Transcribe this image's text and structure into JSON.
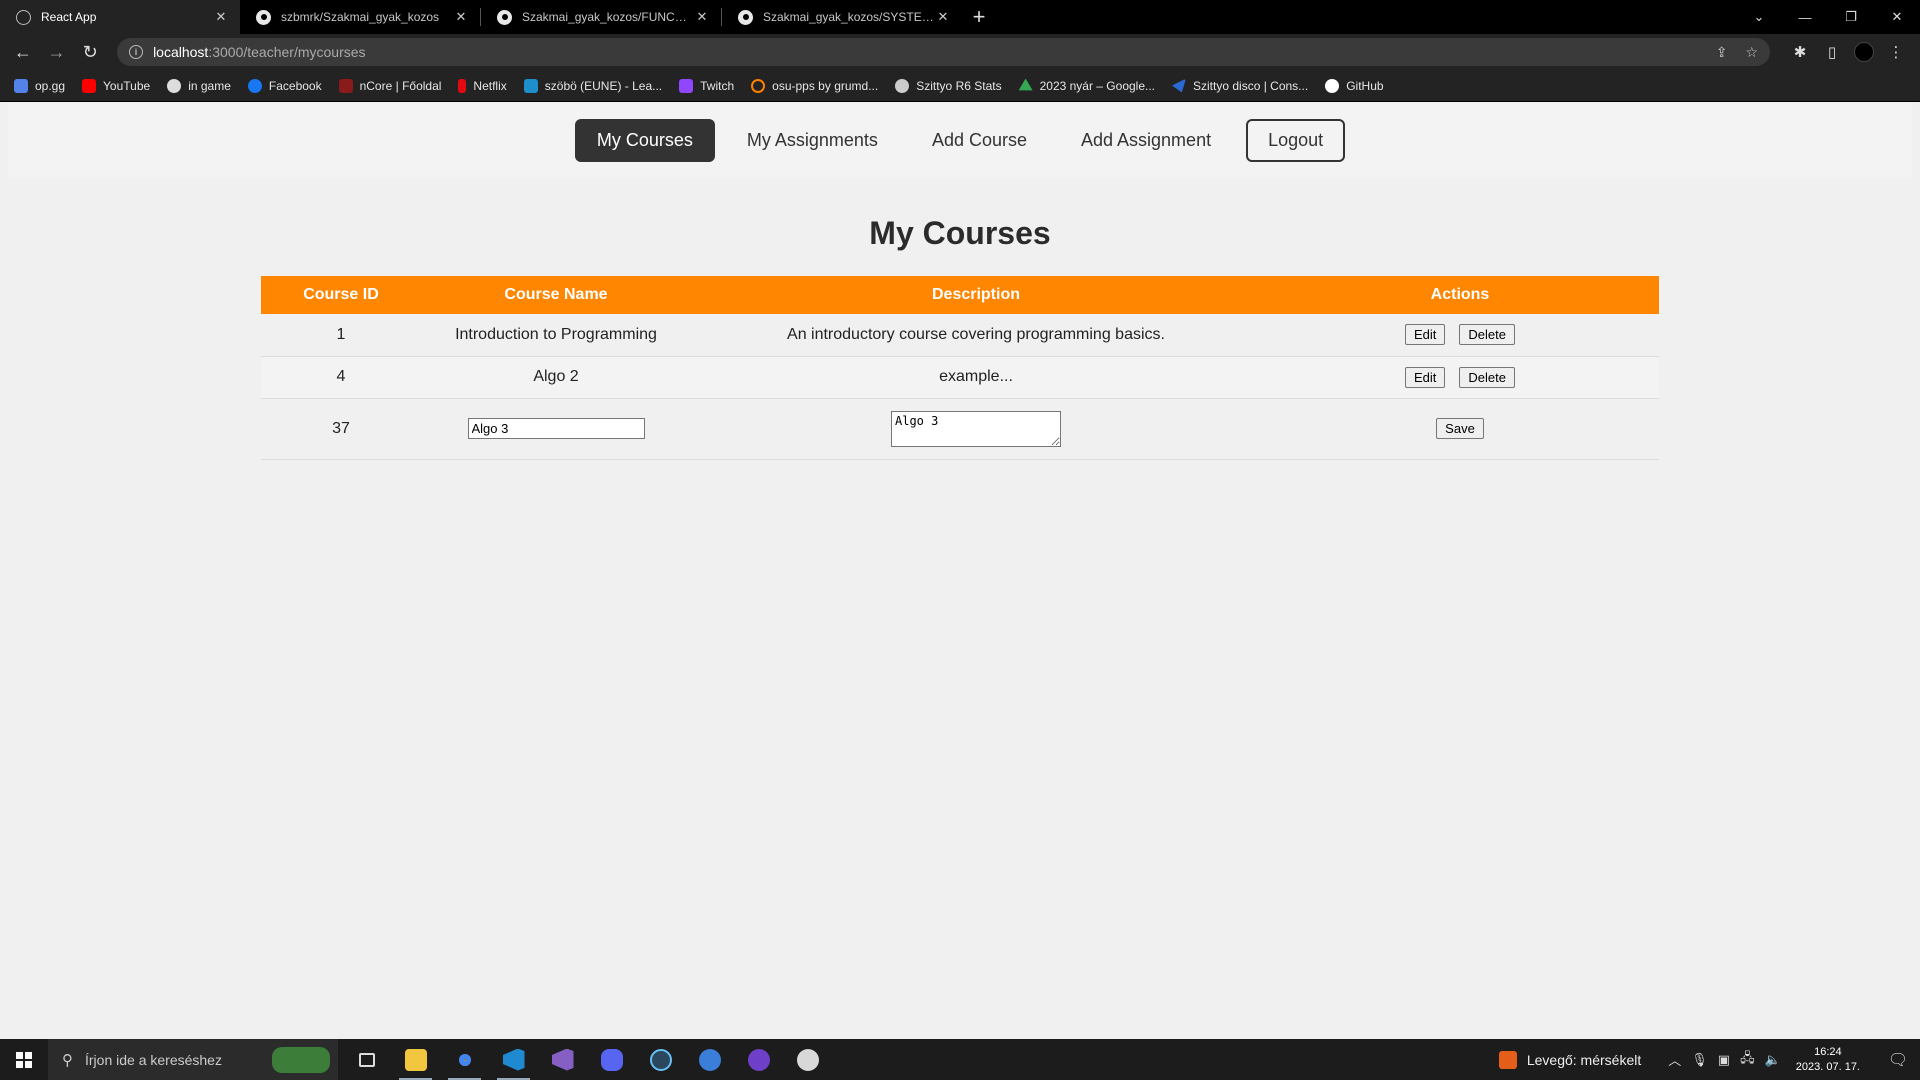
{
  "browser": {
    "tabs": [
      {
        "title": "React App",
        "icon": "react-icon",
        "active": true
      },
      {
        "title": "szbmrk/Szakmai_gyak_kozos",
        "icon": "github-icon",
        "active": false
      },
      {
        "title": "Szakmai_gyak_kozos/FUNCSPEC",
        "icon": "github-icon",
        "active": false
      },
      {
        "title": "Szakmai_gyak_kozos/SYSTEMPLA",
        "icon": "github-icon",
        "active": false
      }
    ],
    "url_host": "localhost",
    "url_path": ":3000/teacher/mycourses",
    "bookmarks": [
      {
        "label": "op.gg",
        "color": "#5383e8"
      },
      {
        "label": "YouTube",
        "color": "#ff0000"
      },
      {
        "label": "in game",
        "color": "#dddddd"
      },
      {
        "label": "Facebook",
        "color": "#1877f2"
      },
      {
        "label": "nCore | Főoldal",
        "color": "#8b1a1a"
      },
      {
        "label": "Netflix",
        "color": "#e50914"
      },
      {
        "label": "szöbö (EUNE) - Lea...",
        "color": "#1f8ecd"
      },
      {
        "label": "Twitch",
        "color": "#9146ff"
      },
      {
        "label": "osu-pps by grumd...",
        "color": "#ff7f00"
      },
      {
        "label": "Szittyo R6 Stats",
        "color": "#cccccc"
      },
      {
        "label": "2023 nyár – Google...",
        "color": "#34a853"
      },
      {
        "label": "Szittyo disco | Cons...",
        "color": "#2a6ad6"
      },
      {
        "label": "GitHub",
        "color": "#ffffff"
      }
    ]
  },
  "nav": {
    "my_courses": "My Courses",
    "my_assignments": "My Assignments",
    "add_course": "Add Course",
    "add_assignment": "Add Assignment",
    "logout": "Logout"
  },
  "page": {
    "title": "My Courses"
  },
  "table": {
    "headers": [
      "Course ID",
      "Course Name",
      "Description",
      "Actions"
    ],
    "rows": [
      {
        "id": "1",
        "name": "Introduction to Programming",
        "description": "An introductory course covering programming basics."
      },
      {
        "id": "4",
        "name": "Algo 2",
        "description": "example..."
      }
    ],
    "edit_row": {
      "id": "37",
      "name_value": "Algo 3",
      "description_value": "Algo 3"
    },
    "edit_label": "Edit",
    "delete_label": "Delete",
    "save_label": "Save"
  },
  "colors": {
    "header_orange": "#ff8600",
    "nav_active": "#333333"
  },
  "taskbar": {
    "search_placeholder": "Írjon ide a kereséshez",
    "weather": "Levegő: mérsékelt",
    "time": "16:24",
    "date": "2023. 07. 17."
  }
}
